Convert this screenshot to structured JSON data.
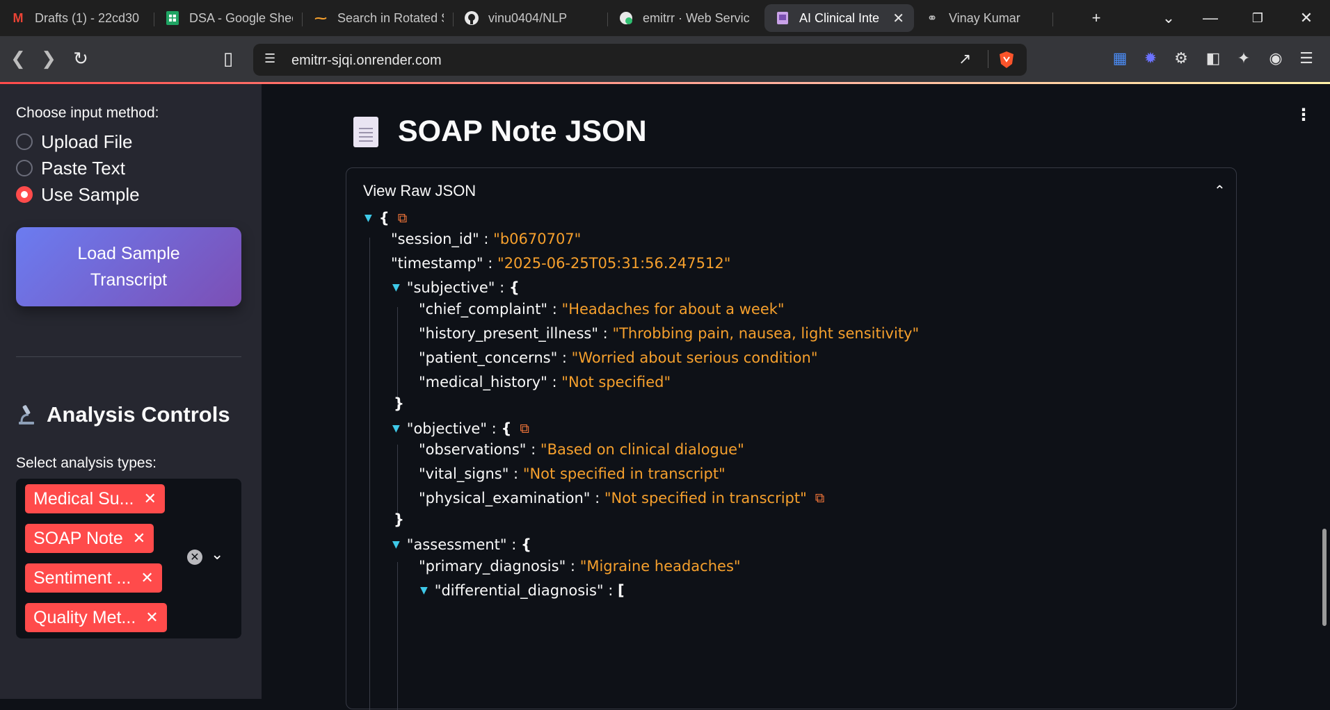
{
  "browser": {
    "tabs": [
      {
        "title": "Drafts (1) - 22cd30",
        "icon": "gmail-icon",
        "active": false
      },
      {
        "title": "DSA - Google Shee",
        "icon": "sheets-icon",
        "active": false
      },
      {
        "title": "Search in Rotated S",
        "icon": "code-icon",
        "active": false
      },
      {
        "title": "vinu0404/NLP",
        "icon": "github-icon",
        "active": false
      },
      {
        "title": "emitrr · Web Servic",
        "icon": "render-icon",
        "active": false
      },
      {
        "title": "AI Clinical Inte",
        "icon": "streamlit-icon",
        "active": true
      },
      {
        "title": "Vinay Kumar",
        "icon": "globe-icon",
        "active": false
      }
    ],
    "url": "emitrr-sjqi.onrender.com"
  },
  "sidebar": {
    "input_label": "Choose input method:",
    "input_options": [
      {
        "label": "Upload File",
        "checked": false
      },
      {
        "label": "Paste Text",
        "checked": false
      },
      {
        "label": "Use Sample",
        "checked": true
      }
    ],
    "load_button_line1": "Load Sample",
    "load_button_line2": "Transcript",
    "controls_title": "Analysis Controls",
    "analysis_label": "Select analysis types:",
    "chips": [
      "Medical Su...",
      "SOAP Note",
      "Sentiment ...",
      "Quality Met..."
    ]
  },
  "main": {
    "title": "SOAP Note JSON",
    "expander_label": "View Raw JSON",
    "json": {
      "open_brace": "{",
      "close_brace": "}",
      "open_bracket": "[",
      "k_session_id": "\"session_id\"",
      "v_session_id": "\"b0670707\"",
      "k_timestamp": "\"timestamp\"",
      "v_timestamp": "\"2025-06-25T05:31:56.247512\"",
      "k_subjective": "\"subjective\"",
      "k_chief_complaint": "\"chief_complaint\"",
      "v_chief_complaint": "\"Headaches for about a week\"",
      "k_history_present_illness": "\"history_present_illness\"",
      "v_history_present_illness": "\"Throbbing pain, nausea, light sensitivity\"",
      "k_patient_concerns": "\"patient_concerns\"",
      "v_patient_concerns": "\"Worried about serious condition\"",
      "k_medical_history": "\"medical_history\"",
      "v_medical_history": "\"Not specified\"",
      "k_objective": "\"objective\"",
      "k_observations": "\"observations\"",
      "v_observations": "\"Based on clinical dialogue\"",
      "k_vital_signs": "\"vital_signs\"",
      "v_vital_signs": "\"Not specified in transcript\"",
      "k_physical_examination": "\"physical_examination\"",
      "v_physical_examination": "\"Not specified in transcript\"",
      "k_assessment": "\"assessment\"",
      "k_primary_diagnosis": "\"primary_diagnosis\"",
      "v_primary_diagnosis": "\"Migraine headaches\"",
      "k_differential_diagnosis": "\"differential_diagnosis\""
    }
  },
  "colors": {
    "accent": "#ff4b4b",
    "json_string": "#f6a02d",
    "json_toggle": "#3ec9e8",
    "background": "#0e1117",
    "sidebar": "#262730"
  }
}
